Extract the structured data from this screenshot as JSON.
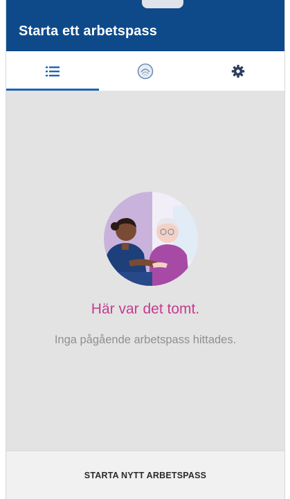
{
  "app": {
    "title": "Starta ett arbetspass"
  },
  "tabs": [
    {
      "icon": "list-icon",
      "active": true
    },
    {
      "icon": "face-recognition-icon",
      "active": false
    },
    {
      "icon": "gear-icon",
      "active": false
    }
  ],
  "empty_state": {
    "illustration": "caregiver-with-elderly-patient",
    "title": "Här var det tomt.",
    "subtitle": "Inga pågående arbetspass hittades."
  },
  "footer": {
    "button_label": "STARTA NYTT ARBETSPASS"
  },
  "colors": {
    "app_bar": "#0e4a8a",
    "tab_indicator": "#1f62b0",
    "empty_title": "#c63b8f",
    "empty_subtitle": "#8f8f8f",
    "background": "#e3e3e3"
  }
}
